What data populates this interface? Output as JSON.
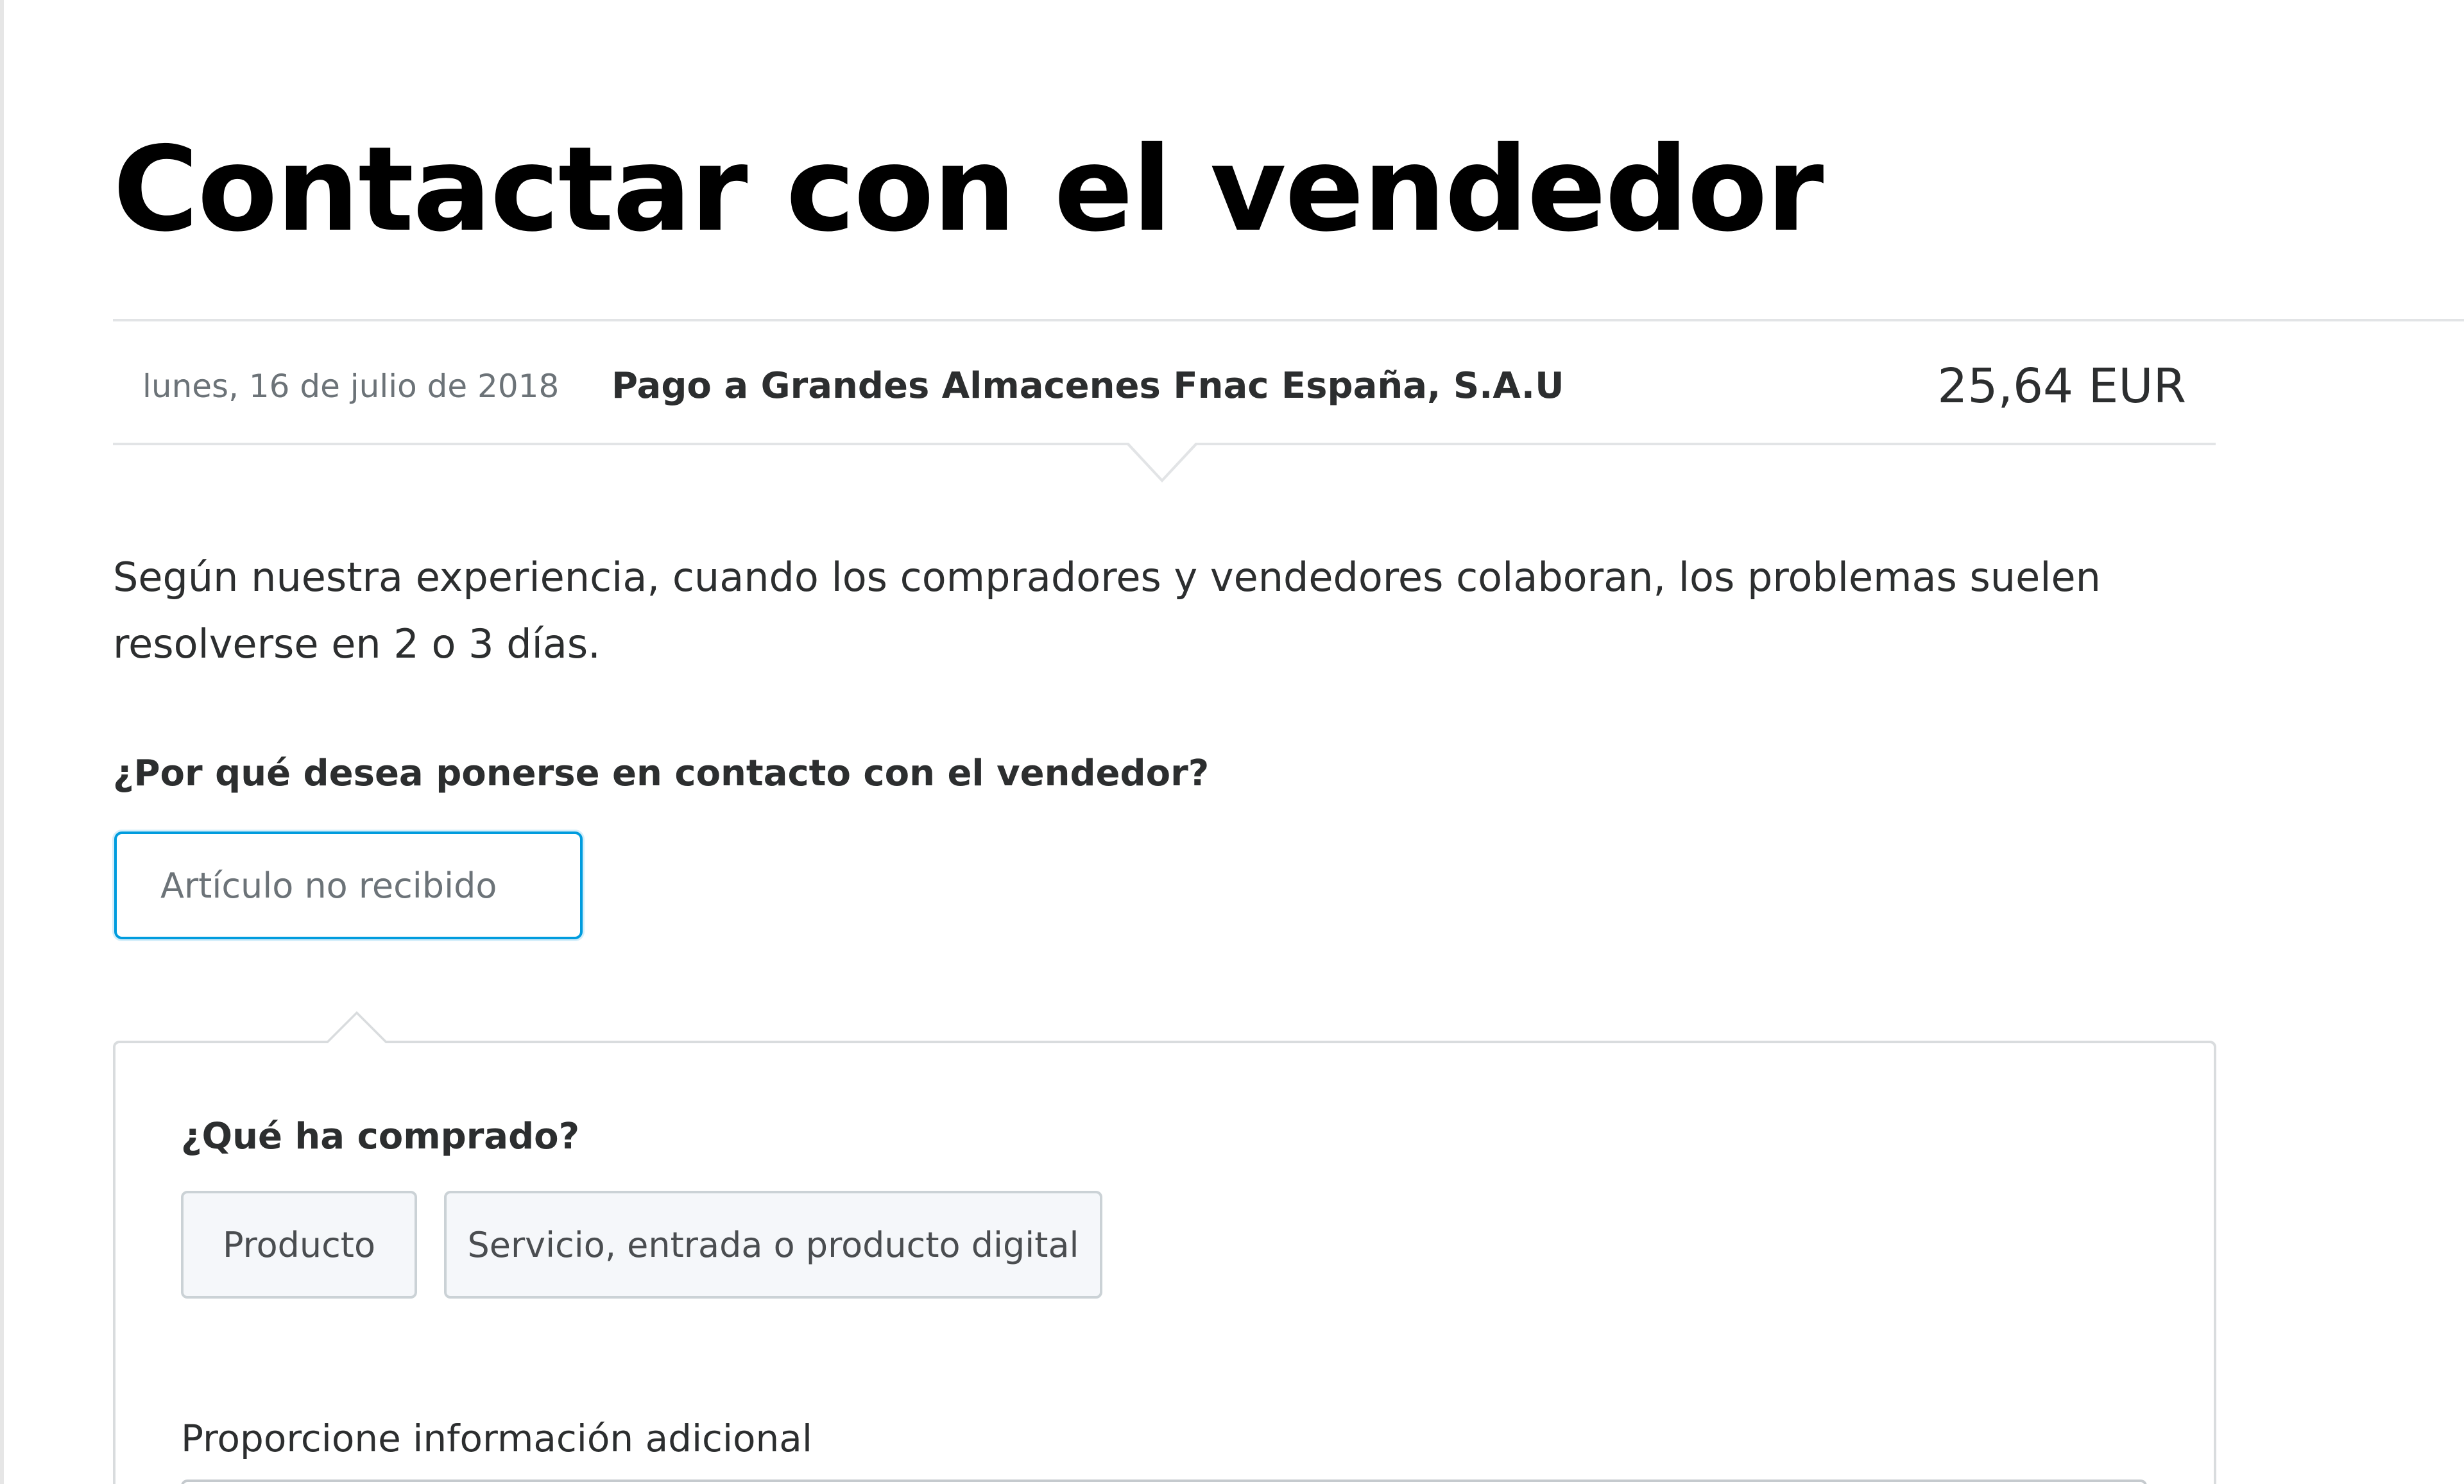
{
  "page": {
    "title": "Contactar con el vendedor"
  },
  "transaction": {
    "date": "lunes, 16 de julio de 2018",
    "merchant": "Pago a Grandes Almacenes Fnac España, S.A.U",
    "amount": "25,64 EUR"
  },
  "intro": {
    "text": "Según nuestra experiencia, cuando los compradores y vendedores colaboran, los problemas suelen resolverse en 2 o 3 días."
  },
  "reason": {
    "question": "¿Por qué desea ponerse en contacto con el vendedor?",
    "selected_value": "Artículo no recibido"
  },
  "purchase": {
    "question": "¿Qué ha comprado?",
    "options": [
      {
        "label": "Producto"
      },
      {
        "label": "Servicio, entrada o producto digital"
      }
    ]
  },
  "additional_info": {
    "label": "Proporcione información adicional"
  },
  "colors": {
    "focus_accent": "#009cde",
    "title": "#000000",
    "body_text": "#2c2e2f",
    "muted_text": "#6c7378",
    "divider": "#e2e4e6"
  }
}
